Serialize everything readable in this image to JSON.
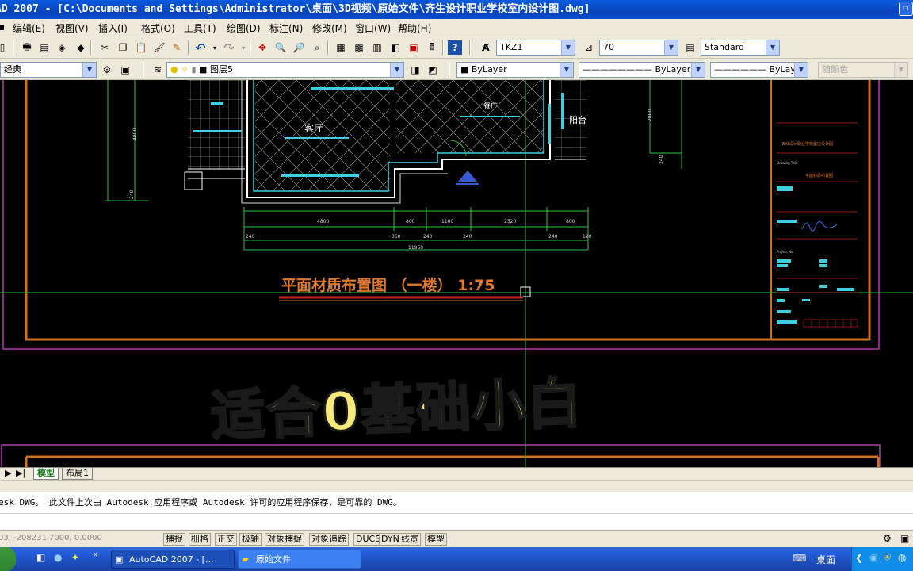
{
  "window": {
    "title": "AD 2007 - [C:\\Documents and Settings\\Administrator\\桌面\\3D视频\\原始文件\\齐生设计职业学校室内设计图.dwg]"
  },
  "menu": [
    "编辑(E)",
    "视图(V)",
    "插入(I)",
    "格式(O)",
    "工具(T)",
    "绘图(D)",
    "标注(N)",
    "修改(M)",
    "窗口(W)",
    "帮助(H)"
  ],
  "toolbar1": {
    "text_style": "TKZ1",
    "dim_value": "70",
    "table_style": "Standard"
  },
  "toolbar2": {
    "workspace": "经典",
    "layer": "图层5",
    "color": "ByLayer",
    "linetype": "ByLayer",
    "lineweight": "ByLayer",
    "plot_style": "随颜色"
  },
  "drawing": {
    "rooms": [
      "客厅",
      "餐厅",
      "阳台"
    ],
    "dimensions_top": [
      "4800",
      "800",
      "1100",
      "2320",
      "800"
    ],
    "dimensions_bottom": [
      "240",
      "360",
      "240",
      "240",
      "240",
      "120"
    ],
    "total_dimension": "11960",
    "vertical_dims": [
      "4800",
      "240",
      "2800",
      "240"
    ],
    "plan_title": "平面材质布置图 （一楼）  1:75",
    "overlay_caption": "适合0基础小白",
    "titleblock": {
      "project": "天红设计职业学校室内设计图",
      "drawing_title": "平面材质布置图",
      "drawing_title_label": "Drawing Title",
      "project_no_label": "Project No"
    }
  },
  "tabs": [
    "模型",
    "布局1"
  ],
  "command_line": {
    "line1": "esk DWG。   此文件上次由 Autodesk 应用程序或 Autodesk 许可的应用程序保存，是可靠的 DWG。"
  },
  "status": {
    "coords": "03, -208231.7000, 0.0000",
    "toggles": [
      "捕捉",
      "栅格",
      "正交",
      "极轴",
      "对象捕捉",
      "对象追踪",
      "DUCS",
      "DYN",
      "线宽",
      "模型"
    ]
  },
  "taskbar": {
    "tasks": [
      "AutoCAD 2007 - [...",
      "原始文件"
    ],
    "tray_label": "桌面"
  }
}
